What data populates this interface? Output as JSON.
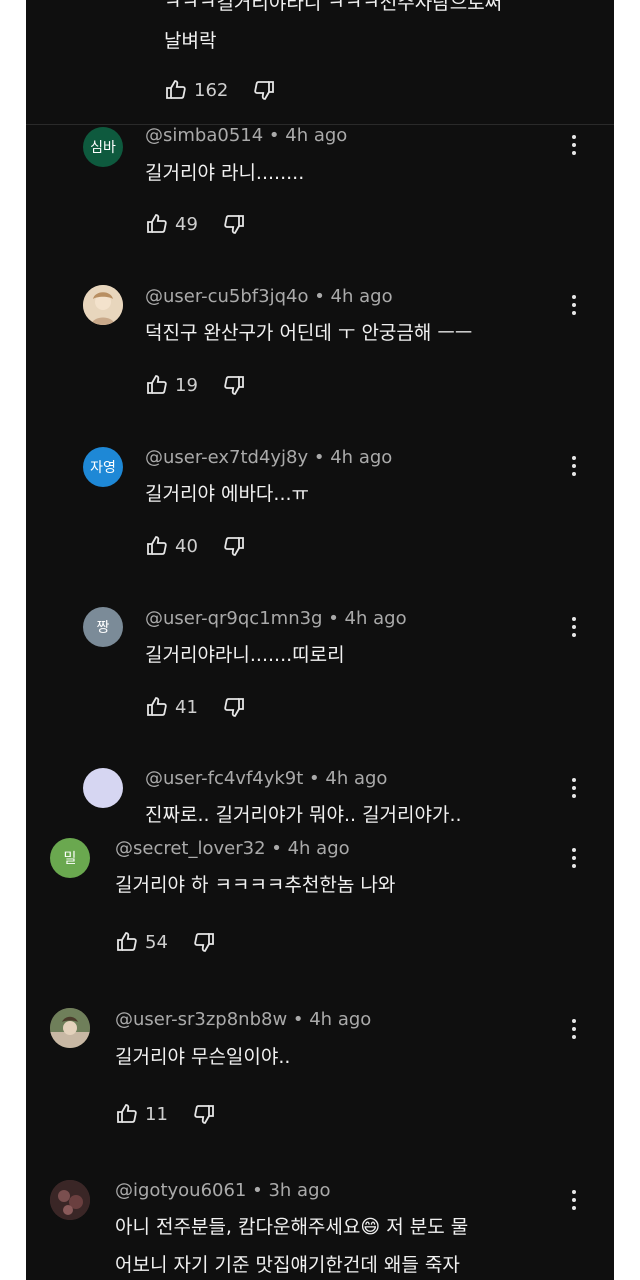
{
  "top_comment": {
    "text_line1": "ㅋㅋㅋ길거리야라니 ㅋㅋㅋ전주사람으로써",
    "text_line2": "날벼락",
    "likes": "162"
  },
  "replies": [
    {
      "handle": "@simba0514",
      "time": "4h ago",
      "avatar_text": "심바",
      "avatar_color": "#0e5a3e",
      "text": "길거리야 라니........",
      "likes": "49"
    },
    {
      "handle": "@user-cu5bf3jq4o",
      "time": "4h ago",
      "avatar_text": "",
      "avatar_color": "#d9c3a8",
      "text": "덕진구 완산구가 어딘데 ㅜ 안궁금해 ㅡㅡ",
      "likes": "19"
    },
    {
      "handle": "@user-ex7td4yj8y",
      "time": "4h ago",
      "avatar_text": "자영",
      "avatar_color": "#1e88d6",
      "text": "길거리야 에바다...ㅠ",
      "likes": "40"
    },
    {
      "handle": "@user-qr9qc1mn3g",
      "time": "4h ago",
      "avatar_text": "짱",
      "avatar_color": "#7b8b98",
      "text": "길거리야라니.......띠로리",
      "likes": "41"
    },
    {
      "handle": "@user-fc4vf4yk9t",
      "time": "4h ago",
      "avatar_text": "",
      "avatar_color": "#d6d6f2",
      "text": "진짜로.. 길거리야가 뭐야.. 길거리야가..",
      "likes": ""
    }
  ],
  "comments": [
    {
      "handle": "@secret_lover32",
      "time": "4h ago",
      "avatar_text": "밀",
      "avatar_color": "#6aa84f",
      "text": "길거리야 하 ㅋㅋㅋㅋ추천한놈 나와",
      "likes": "54"
    },
    {
      "handle": "@user-sr3zp8nb8w",
      "time": "4h ago",
      "avatar_text": "",
      "avatar_color": "#8b7a6a",
      "text": "길거리야 무슨일이야..",
      "likes": "11"
    },
    {
      "handle": "@igotyou6061",
      "time": "3h ago",
      "avatar_text": "",
      "avatar_color": "#5a3a3a",
      "text_line1": "아니 전주분들, 캄다운해주세요😄 저 분도 물",
      "text_line2": "어보니 자기 기준 맛집얘기한건데 왜들 죽자",
      "likes": ""
    }
  ],
  "separator": " • "
}
